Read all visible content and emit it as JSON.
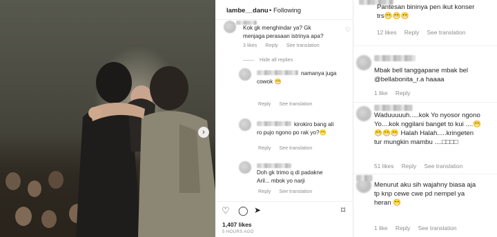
{
  "post": {
    "username": "lambe__danu",
    "follow_text": "• Following",
    "likes": "1,407 likes",
    "time": "5 HOURS AGO"
  },
  "icons": {
    "next_arrow": "chevron-right-icon",
    "heart": "heart-icon",
    "comment": "comment-icon",
    "share": "share-icon",
    "bookmark": "bookmark-icon"
  },
  "middle_comments": {
    "c1": {
      "text_line1": "Kok gk menghindar ya? Gk",
      "text_line2": "menjaga perasaan istrinya apa?",
      "likes": "3 likes",
      "reply": "Reply",
      "see_translation": "See translation"
    },
    "hide_replies": "Hide all replies",
    "r1": {
      "text_line1": "namanya juga",
      "text_line2": "cowok 😁",
      "reply": "Reply",
      "see_translation": "See translation"
    },
    "r2": {
      "text_line1": "kirokiro bang ali",
      "text_line2": "ro pujo ngono po rak yo?😁",
      "reply": "Reply",
      "see_translation": "See translation"
    },
    "r3": {
      "text_line1": "Doh gk trimo q di padakne",
      "text_line2": "Aril... mbok yo narji",
      "reply": "Reply",
      "see_translation": "See translation"
    }
  },
  "right_comments": {
    "c1": {
      "text_line1": "Pantesan bininya pen ikut konser",
      "text_line2": "trs😁😁😁",
      "likes": "12 likes",
      "reply": "Reply",
      "see_translation": "See translation"
    },
    "c2": {
      "text_line1": "Mbak bell tanggapane mbak bel",
      "text_line2": "@bellabonita_r.a haaaa",
      "likes": "1 like",
      "reply": "Reply"
    },
    "c3": {
      "text_line1": "Waduuuuuh.....kok Yo nyosor ngono",
      "text_line2": "Yo....kok nggilani banget to kui ....😁",
      "text_line3": "😁😁😁 Halah Halah.....kringeten",
      "text_line4": "tur mungkin mambu ....□□□□",
      "likes": "51 likes",
      "reply": "Reply",
      "see_translation": "See translation"
    },
    "c4": {
      "text_line1": "Menurut aku sih wajahny biasa aja",
      "text_line2": "tp knp cewe cwe pd nempel ya",
      "text_line3": "heran 😁",
      "likes": "1 like",
      "reply": "Reply",
      "see_translation": "See translation"
    }
  }
}
